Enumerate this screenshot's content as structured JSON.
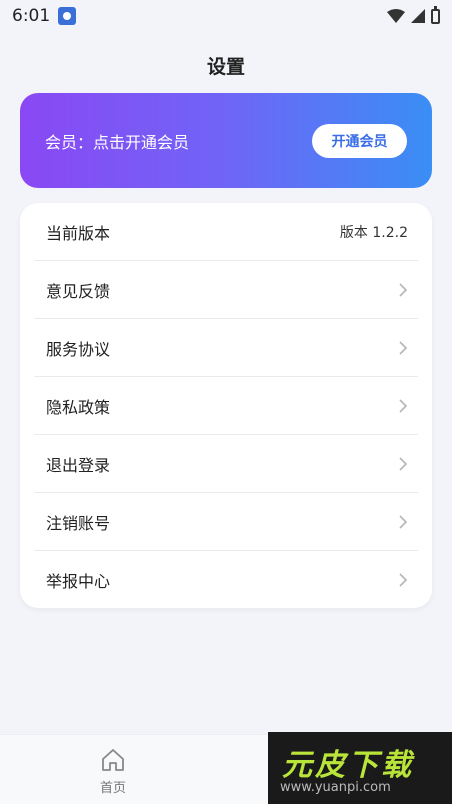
{
  "status_bar": {
    "time": "6:01"
  },
  "header": {
    "title": "设置"
  },
  "vip": {
    "text": "会员：点击开通会员",
    "button_label": "开通会员"
  },
  "settings": {
    "items": [
      {
        "label": "当前版本",
        "value": "版本 1.2.2"
      },
      {
        "label": "意见反馈"
      },
      {
        "label": "服务协议"
      },
      {
        "label": "隐私政策"
      },
      {
        "label": "退出登录"
      },
      {
        "label": "注销账号"
      },
      {
        "label": "举报中心"
      }
    ]
  },
  "bottom_nav": {
    "home_label": "首页"
  },
  "watermark": {
    "logo": "元皮下载",
    "url": "www.yuanpi.com"
  },
  "colors": {
    "accent": "#3a6ee8",
    "gradient_start": "#8a48f4",
    "gradient_end": "#3a8ef5"
  }
}
